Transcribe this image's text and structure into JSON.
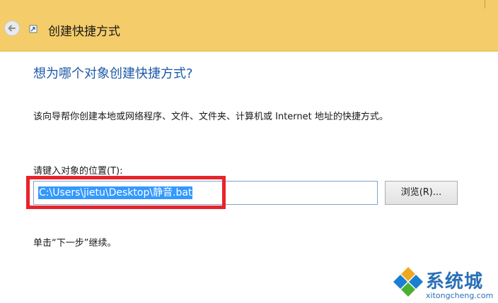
{
  "window": {
    "title": "创建快捷方式"
  },
  "content": {
    "heading": "想为哪个对象创建快捷方式?",
    "description": "该向导帮你创建本地或网络程序、文件、文件夹、计算机或 Internet 地址的快捷方式。",
    "location_label": "请键入对象的位置(T):",
    "location_value": "C:\\Users\\jietu\\Desktop\\静音.bat",
    "browse_label": "浏览(R)...",
    "next_hint": "单击“下一步”继续。"
  },
  "watermark": {
    "name": "系统城",
    "url": "xitongcheng.com"
  },
  "colors": {
    "titlebar": "#f4cd6a",
    "heading": "#1e5aa8",
    "highlight": "#e8232a",
    "selection": "#3399ff"
  },
  "icons": {
    "back": "back-arrow-icon",
    "wizard": "shortcut-wizard-icon",
    "watermark_logo": "diamond-logo-icon"
  }
}
